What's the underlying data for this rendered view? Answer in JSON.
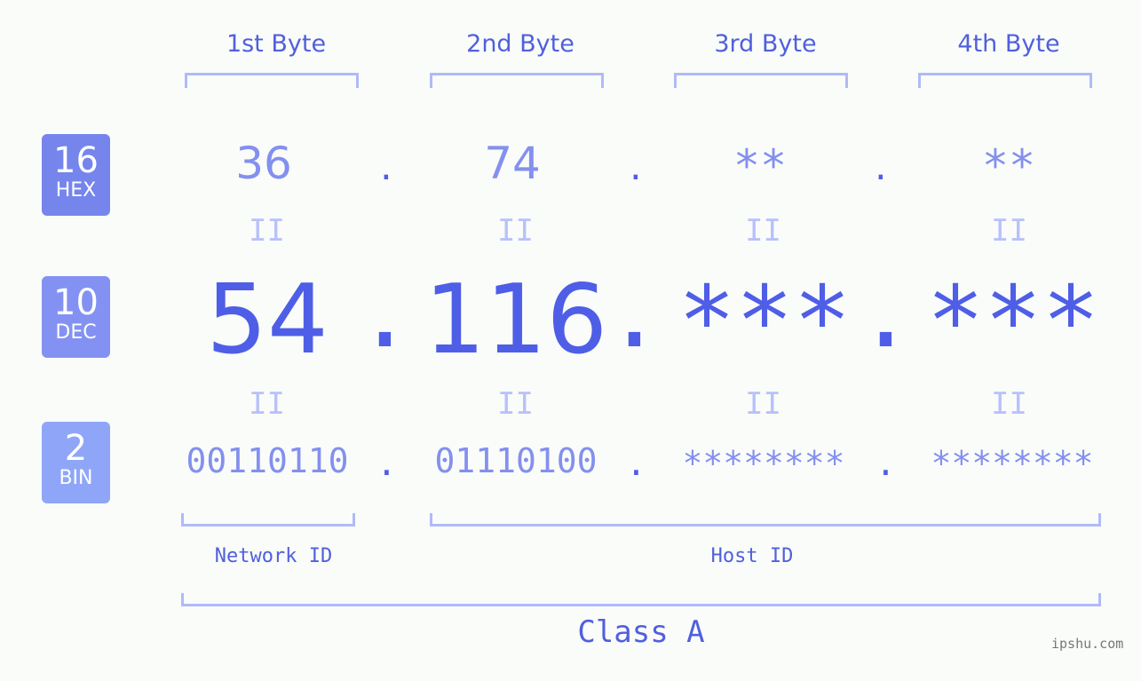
{
  "badges": [
    {
      "num": "16",
      "label": "HEX",
      "color": "#7585ec"
    },
    {
      "num": "10",
      "label": "DEC",
      "color": "#8392f2"
    },
    {
      "num": "2",
      "label": "BIN",
      "color": "#8fa6f8"
    }
  ],
  "byte_headers": [
    "1st Byte",
    "2nd Byte",
    "3rd Byte",
    "4th Byte"
  ],
  "hex": [
    "36",
    "74",
    "**",
    "**"
  ],
  "dec": [
    "54",
    "116",
    "***",
    "***"
  ],
  "bin": [
    "00110110",
    "01110100",
    "********",
    "********"
  ],
  "separator": ".",
  "equals": "II",
  "network_id": "Network ID",
  "host_id": "Host ID",
  "class_label": "Class A",
  "watermark": "ipshu.com"
}
